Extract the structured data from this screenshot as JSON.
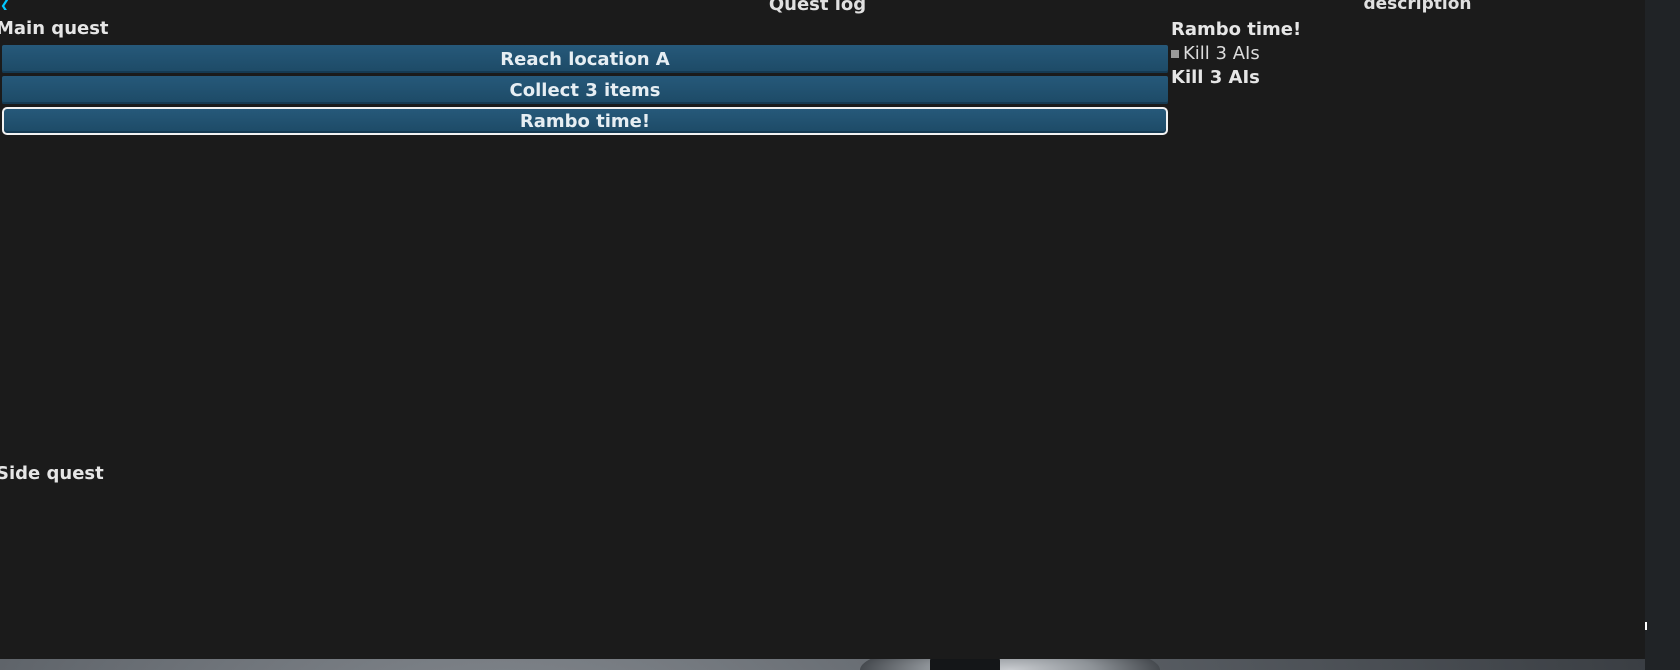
{
  "header": {
    "title": "Quest log",
    "description_title": "description"
  },
  "main_quest": {
    "label": "Main quest",
    "quests": [
      {
        "label": "Reach location A",
        "selected": false
      },
      {
        "label": "Collect 3 items",
        "selected": false
      },
      {
        "label": "Rambo time!",
        "selected": true
      }
    ]
  },
  "side_quest": {
    "label": "Side quest"
  },
  "description": {
    "quest_name": "Rambo time!",
    "objectives": [
      {
        "label": "Kill 3 AIs"
      }
    ],
    "text": "Kill 3 AIs"
  },
  "colors": {
    "panel_bg": "#1b1b1b",
    "button_bg": "#26597a",
    "accent": "#00c8ff"
  }
}
